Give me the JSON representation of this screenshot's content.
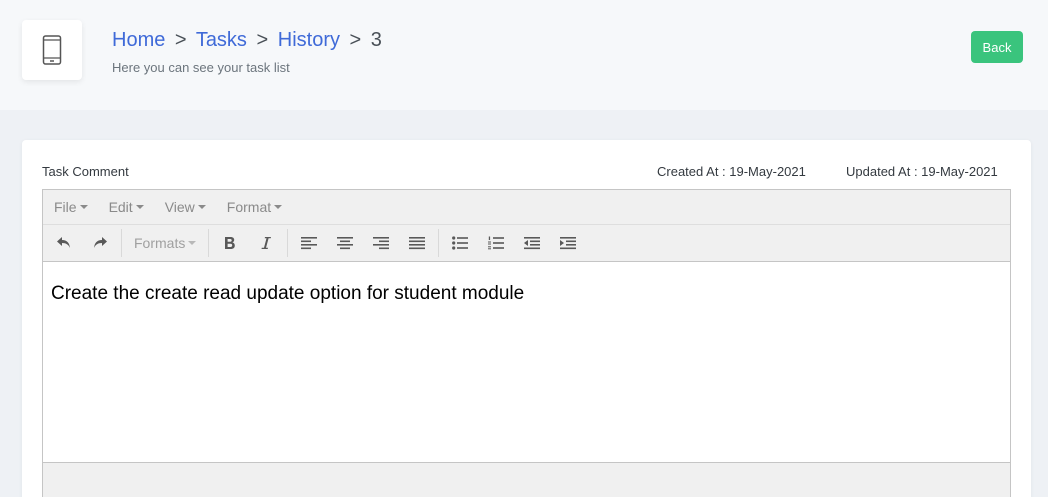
{
  "header": {
    "breadcrumb": [
      {
        "label": "Home"
      },
      {
        "label": "Tasks"
      },
      {
        "label": "History"
      },
      {
        "label": "3"
      }
    ],
    "separator": ">",
    "subtitle": "Here you can see your task list",
    "back_label": "Back",
    "icon": "mobile-phone-icon"
  },
  "card": {
    "field_label": "Task Comment",
    "created_at": "Created At : 19-May-2021",
    "updated_at": "Updated At : 19-May-2021"
  },
  "editor": {
    "menu": [
      "File",
      "Edit",
      "View",
      "Format"
    ],
    "formats_label": "Formats",
    "content": "Create the create read update option for student module"
  },
  "colors": {
    "link": "#3f6ad8",
    "success": "#3ac47d"
  }
}
